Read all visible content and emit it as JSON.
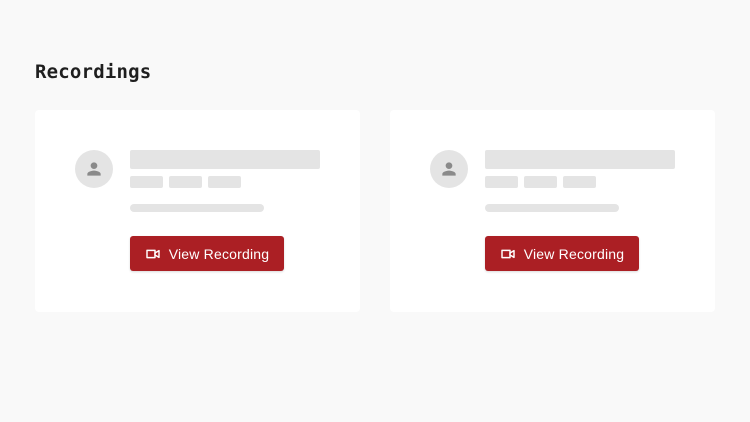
{
  "page": {
    "title": "Recordings"
  },
  "recordings": [
    {
      "button_label": "View Recording",
      "button_icon": "video-camera-icon",
      "avatar_icon": "person-icon"
    },
    {
      "button_label": "View Recording",
      "button_icon": "video-camera-icon",
      "avatar_icon": "person-icon"
    }
  ],
  "colors": {
    "background": "#f9f9f9",
    "card": "#ffffff",
    "skeleton": "#e4e4e4",
    "accent": "#ab1f24",
    "avatar_icon": "#8a8a8a"
  }
}
